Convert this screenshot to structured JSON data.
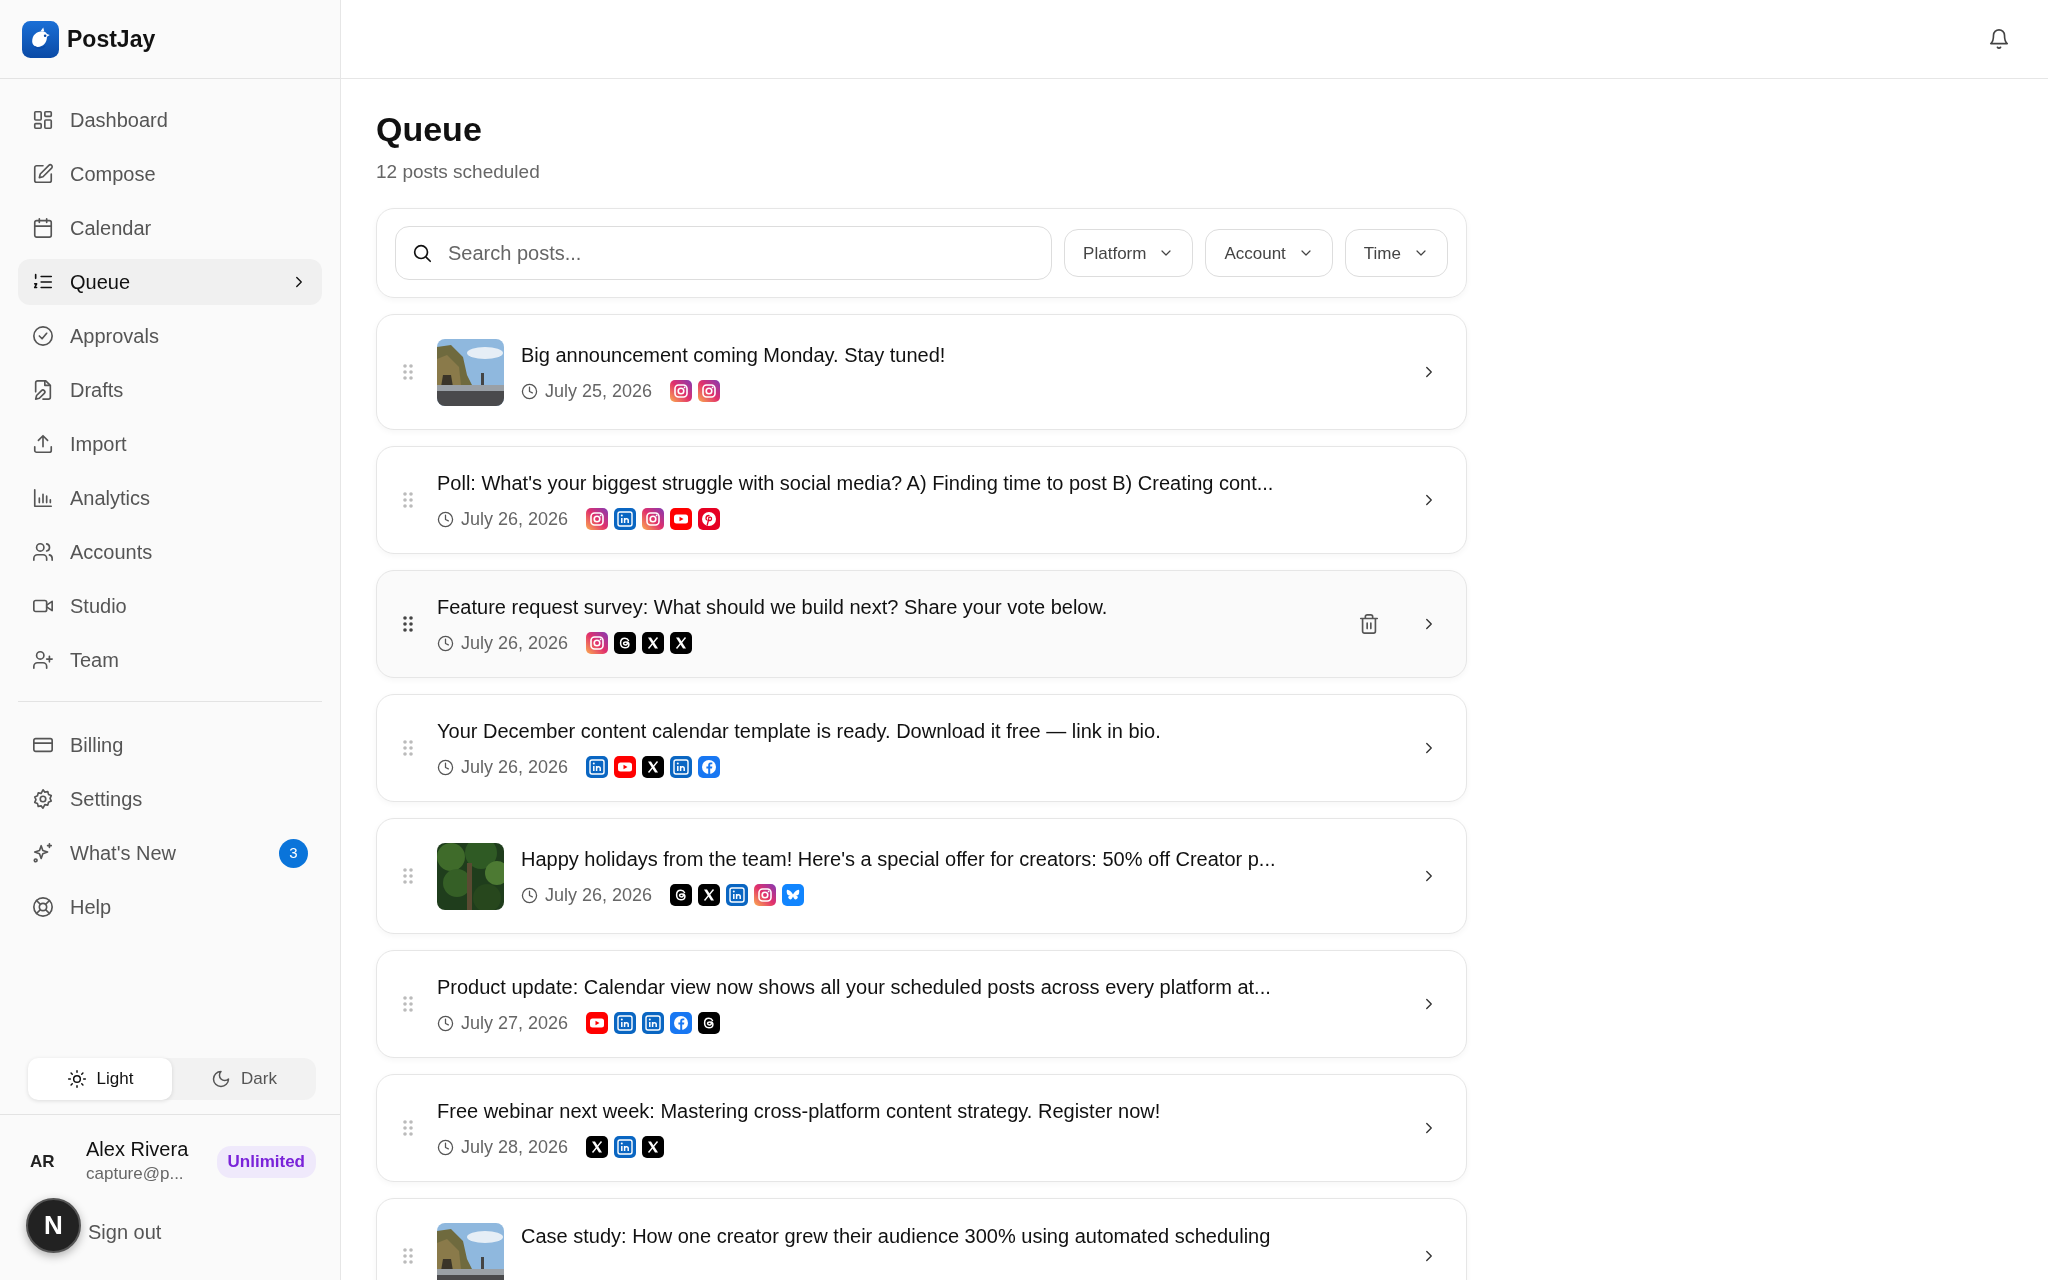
{
  "app": {
    "name": "PostJay"
  },
  "nav": [
    {
      "label": "Dashboard",
      "selected": false
    },
    {
      "label": "Compose",
      "selected": false
    },
    {
      "label": "Calendar",
      "selected": false
    },
    {
      "label": "Queue",
      "selected": true
    },
    {
      "label": "Approvals",
      "selected": false
    },
    {
      "label": "Drafts",
      "selected": false
    },
    {
      "label": "Import",
      "selected": false
    },
    {
      "label": "Analytics",
      "selected": false
    },
    {
      "label": "Accounts",
      "selected": false
    },
    {
      "label": "Studio",
      "selected": false
    },
    {
      "label": "Team",
      "selected": false
    }
  ],
  "nav_secondary": [
    {
      "label": "Billing",
      "selected": false
    },
    {
      "label": "Settings",
      "selected": false
    },
    {
      "label": "What's New",
      "selected": false,
      "badge": "3"
    },
    {
      "label": "Help",
      "selected": false
    }
  ],
  "theme_toggle": [
    {
      "label": "Light",
      "selected": true
    },
    {
      "label": "Dark",
      "selected": false
    }
  ],
  "user": {
    "initials": "AR",
    "name": "Alex Rivera",
    "email": "capture@p...",
    "plan": "Unlimited"
  },
  "sign_out": "Sign out",
  "dev_indicator": "N",
  "page": {
    "title": "Queue",
    "subtitle": "12 posts scheduled"
  },
  "search": {
    "placeholder": "Search posts..."
  },
  "filters": [
    "Platform",
    "Account",
    "Time"
  ],
  "posts": [
    {
      "text": "Big announcement coming Monday. Stay tuned!",
      "date": "July 25, 2026",
      "thumbnail": true,
      "hovered": false,
      "platforms": [
        {
          "kind": "instagram"
        },
        {
          "kind": "instagram"
        }
      ]
    },
    {
      "text": "Poll: What's your biggest struggle with social media? A) Finding time to post B) Creating cont...",
      "date": "July 26, 2026",
      "thumbnail": false,
      "hovered": false,
      "platforms": [
        {
          "kind": "instagram"
        },
        {
          "kind": "linkedin"
        },
        {
          "kind": "instagram"
        },
        {
          "kind": "youtube"
        },
        {
          "kind": "pinterest"
        }
      ]
    },
    {
      "text": "Feature request survey: What should we build next? Share your vote below.",
      "date": "July 26, 2026",
      "thumbnail": false,
      "hovered": true,
      "platforms": [
        {
          "kind": "instagram"
        },
        {
          "kind": "threads"
        },
        {
          "kind": "x"
        },
        {
          "kind": "x"
        }
      ]
    },
    {
      "text": "Your December content calendar template is ready. Download it free — link in bio.",
      "date": "July 26, 2026",
      "thumbnail": false,
      "hovered": false,
      "platforms": [
        {
          "kind": "linkedin"
        },
        {
          "kind": "youtube"
        },
        {
          "kind": "x"
        },
        {
          "kind": "linkedin"
        },
        {
          "kind": "facebook"
        }
      ]
    },
    {
      "text": "Happy holidays from the team! Here's a special offer for creators: 50% off Creator p...",
      "date": "July 26, 2026",
      "thumbnail": true,
      "hovered": false,
      "platforms": [
        {
          "kind": "threads"
        },
        {
          "kind": "x"
        },
        {
          "kind": "linkedin"
        },
        {
          "kind": "instagram"
        },
        {
          "kind": "bluesky"
        }
      ]
    },
    {
      "text": "Product update: Calendar view now shows all your scheduled posts across every platform at...",
      "date": "July 27, 2026",
      "thumbnail": false,
      "hovered": false,
      "platforms": [
        {
          "kind": "youtube"
        },
        {
          "kind": "linkedin"
        },
        {
          "kind": "linkedin"
        },
        {
          "kind": "facebook"
        },
        {
          "kind": "threads"
        }
      ]
    },
    {
      "text": "Free webinar next week: Mastering cross-platform content strategy. Register now!",
      "date": "July 28, 2026",
      "thumbnail": false,
      "hovered": false,
      "platforms": [
        {
          "kind": "x"
        },
        {
          "kind": "linkedin"
        },
        {
          "kind": "x"
        }
      ]
    },
    {
      "text": "Case study: How one creator grew their audience 300% using automated scheduling",
      "thumbnail": true,
      "hovered": false
    }
  ]
}
